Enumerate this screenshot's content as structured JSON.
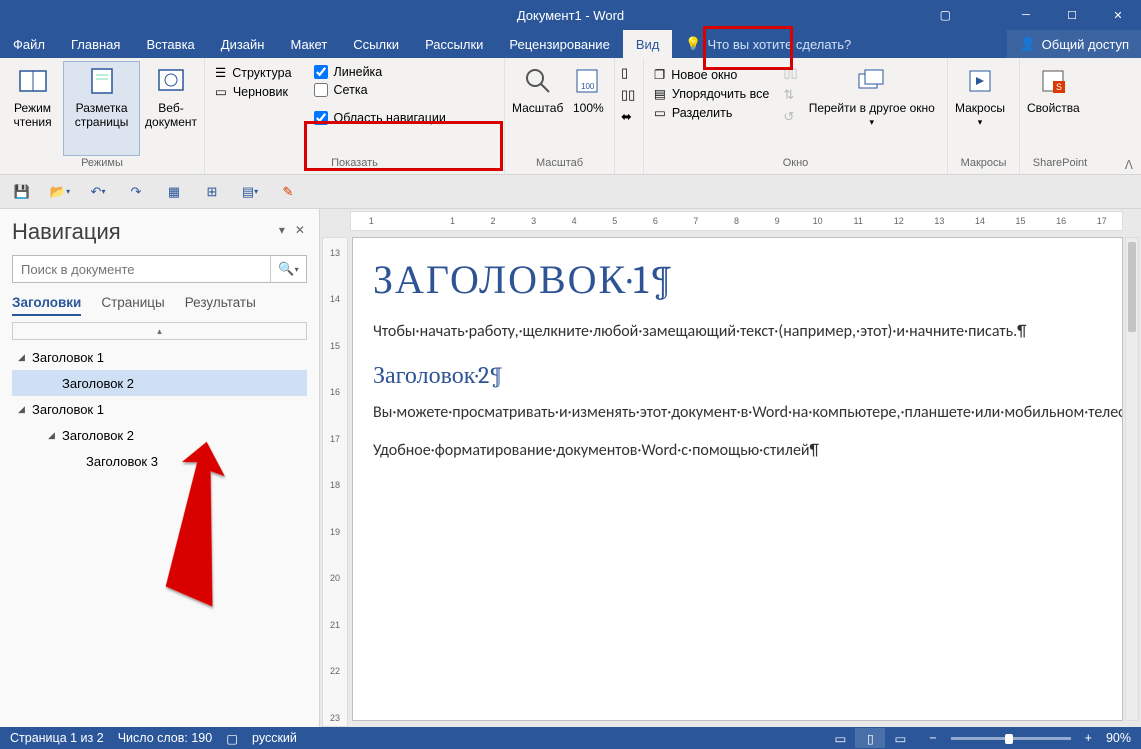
{
  "window": {
    "title": "Документ1 - Word"
  },
  "tabs": {
    "file": "Файл",
    "home": "Главная",
    "insert": "Вставка",
    "design": "Дизайн",
    "layout": "Макет",
    "references": "Ссылки",
    "mailings": "Рассылки",
    "review": "Рецензирование",
    "view": "Вид",
    "tellme": "Что вы хотите сделать?",
    "share": "Общий доступ"
  },
  "ribbon": {
    "views_group": "Режимы",
    "read_mode": "Режим чтения",
    "print_layout": "Разметка страницы",
    "web_layout": "Веб-документ",
    "show_group": "Показать",
    "outline": "Структура",
    "draft": "Черновик",
    "ruler": "Линейка",
    "gridlines": "Сетка",
    "navpane": "Область навигации",
    "zoom_group": "Масштаб",
    "zoom": "Масштаб",
    "onehundred": "100%",
    "window_group": "Окно",
    "new_window": "Новое окно",
    "arrange_all": "Упорядочить все",
    "split": "Разделить",
    "switch_windows": "Перейти в другое окно",
    "macros_group": "Макросы",
    "macros": "Макросы",
    "sharepoint_group": "SharePoint",
    "properties": "Свойства"
  },
  "nav": {
    "title": "Навигация",
    "search_ph": "Поиск в документе",
    "tab_headings": "Заголовки",
    "tab_pages": "Страницы",
    "tab_results": "Результаты",
    "items": [
      {
        "level": 1,
        "label": "Заголовок 1",
        "expanded": true
      },
      {
        "level": 2,
        "label": "Заголовок 2",
        "selected": true
      },
      {
        "level": 1,
        "label": "Заголовок 1",
        "expanded": true
      },
      {
        "level": 2,
        "label": "Заголовок 2",
        "expanded": true
      },
      {
        "level": 3,
        "label": "Заголовок 3"
      }
    ]
  },
  "doc": {
    "h1": "ЗАГОЛОВОК·1¶",
    "p1": "Чтобы·начать·работу,·щелкните·любой·замещающий·текст·(например,·этот)·и·начните·писать.¶",
    "h2": "Заголовок·2¶",
    "p2": "Вы·можете·просматривать·и·изменять·этот·документ·в·Word·на·компьютере,·планшете·или·мобильном·телефоне.·Редактируйте·текст,·вставляйте·содержимое,·например·рисунки,·фигуры·и·таблицы,·и·сохраняйте·документ·в·облаке·с·помощью·приложения·Word·на·компьютерах·Mac,·устройствах·с·Windows,·Android·или·iOS.¶",
    "p3": "Удобное·форматирование·документов·Word·с·помощью·стилей¶"
  },
  "status": {
    "page": "Страница 1 из 2",
    "words": "Число слов: 190",
    "lang": "русский",
    "zoom": "90%"
  },
  "hruler_ticks": [
    "1",
    "",
    "1",
    "2",
    "3",
    "4",
    "5",
    "6",
    "7",
    "8",
    "9",
    "10",
    "11",
    "12",
    "13",
    "14",
    "15",
    "16",
    "17"
  ],
  "vruler_ticks": [
    "13",
    "",
    "14",
    "",
    "15",
    "",
    "16",
    "",
    "17",
    "",
    "18",
    "",
    "19",
    "",
    "20",
    "",
    "21",
    "",
    "22",
    "",
    "23"
  ]
}
